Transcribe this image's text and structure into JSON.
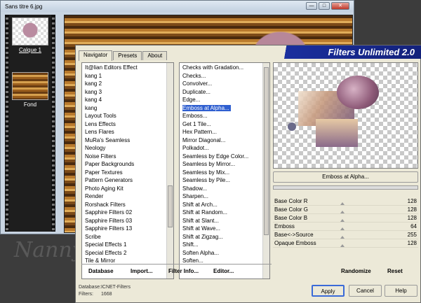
{
  "background_window": {
    "title": "Sans titre 6.jpg",
    "buttons": [
      "—",
      "□",
      "✕"
    ],
    "layers": [
      {
        "name": "Calque 1"
      },
      {
        "name": "Fond"
      }
    ]
  },
  "watermark": "Nanny",
  "dialog": {
    "title": "Filters Unlimited 2.0",
    "tabs": [
      "Navigator",
      "Presets",
      "About"
    ],
    "categories": [
      "It@lian Editors Effect",
      "kang 1",
      "kang 2",
      "kang 3",
      "kang 4",
      "kang",
      "Layout Tools",
      "Lens Effects",
      "Lens Flares",
      "MuRa's Seamless",
      "Neology",
      "Noise Filters",
      "Paper Backgrounds",
      "Paper Textures",
      "Pattern Generators",
      "Photo Aging Kit",
      "Render",
      "Rorshack Filters",
      "Sapphire Filters 02",
      "Sapphire Filters 03",
      "Sapphire Filters 13",
      "Scribe",
      "Special Effects 1",
      "Special Effects 2",
      "Tile & Mirror"
    ],
    "filters": [
      "Checks with Gradation...",
      "Checks...",
      "Convolver...",
      "Duplicate...",
      "Edge...",
      "Emboss at Alpha...",
      "Emboss...",
      "Get 1 Tile...",
      "Hex Pattern...",
      "Mirror Diagonal...",
      "Polkadot...",
      "Seamless by Edge Color...",
      "Seamless by Mirror...",
      "Seamless by Mix...",
      "Seamless by Pile...",
      "Shadow...",
      "Sharpen...",
      "Shift at Arch...",
      "Shift at Random...",
      "Shift at Slant...",
      "Shift at Wave...",
      "Shift at Zigzag...",
      "Shift...",
      "Soften Alpha...",
      "Soften..."
    ],
    "selected_filter_index": 5,
    "preview_label": "Emboss at Alpha...",
    "params": [
      {
        "label": "Base Color R",
        "value": "128"
      },
      {
        "label": "Base Color G",
        "value": "128"
      },
      {
        "label": "Base Color B",
        "value": "128"
      },
      {
        "label": "Emboss",
        "value": "64"
      },
      {
        "label": "Base<->Source",
        "value": "255"
      },
      {
        "label": "Opaque Emboss",
        "value": "128"
      }
    ],
    "list_buttons": [
      "Database",
      "Import...",
      "Filter Info...",
      "Editor..."
    ],
    "randomize_label": "Randomize",
    "reset_label": "Reset",
    "info": {
      "database_label": "Database:",
      "database_value": "ICNET-Filters",
      "filters_label": "Filters:",
      "filters_value": "1668"
    },
    "apply_label": "Apply",
    "cancel_label": "Cancel",
    "help_label": "Help",
    "banner_color": "#1a2f9e"
  }
}
